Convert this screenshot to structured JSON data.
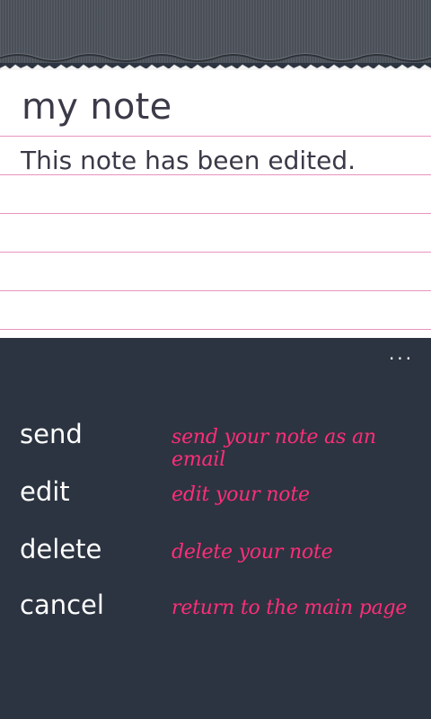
{
  "note": {
    "title": "my note",
    "body": "This note has been edited."
  },
  "appbar": {
    "more_label": "...",
    "menu": [
      {
        "label": "send",
        "description": "send your note as an email"
      },
      {
        "label": "edit",
        "description": "edit your note"
      },
      {
        "label": "delete",
        "description": "delete your note"
      },
      {
        "label": "cancel",
        "description": "return to the main page"
      }
    ]
  },
  "colors": {
    "accent": "#ff2d78",
    "rule": "#e894bf",
    "appbar_bg": "#2c3441",
    "binder": "#4a4f58"
  }
}
